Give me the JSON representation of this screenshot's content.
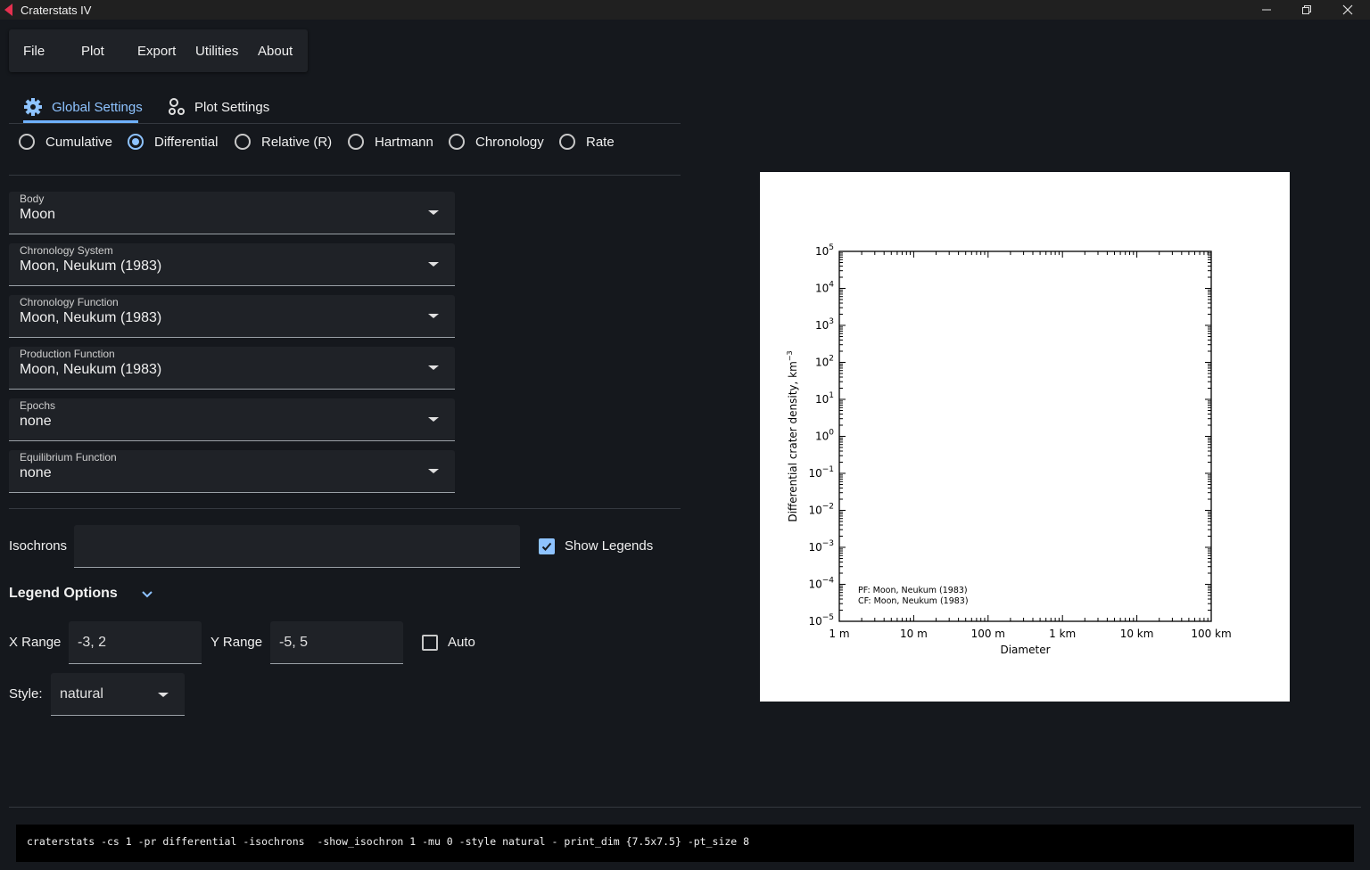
{
  "window": {
    "title": "Craterstats IV"
  },
  "menu": {
    "file": "File",
    "plot": "Plot",
    "export": "Export",
    "utilities": "Utilities",
    "about": "About"
  },
  "tabs": {
    "global": "Global Settings",
    "plot": "Plot Settings"
  },
  "presentation": {
    "options": [
      "Cumulative",
      "Differential",
      "Relative (R)",
      "Hartmann",
      "Chronology",
      "Rate"
    ],
    "selected": "Differential"
  },
  "fields": {
    "body": {
      "label": "Body",
      "value": "Moon"
    },
    "chronology_system": {
      "label": "Chronology System",
      "value": "Moon, Neukum (1983)"
    },
    "chronology_function": {
      "label": "Chronology Function",
      "value": "Moon, Neukum (1983)"
    },
    "production_function": {
      "label": "Production Function",
      "value": "Moon, Neukum (1983)"
    },
    "epochs": {
      "label": "Epochs",
      "value": "none"
    },
    "equilibrium_function": {
      "label": "Equilibrium Function",
      "value": "none"
    }
  },
  "isochrons": {
    "label": "Isochrons",
    "value": ""
  },
  "show_legends": {
    "label": "Show Legends",
    "checked": true
  },
  "legend_options": {
    "label": "Legend Options"
  },
  "x_range": {
    "label": "X Range",
    "value": "-3, 2"
  },
  "y_range": {
    "label": "Y Range",
    "value": "-5, 5"
  },
  "auto": {
    "label": "Auto",
    "checked": false
  },
  "style": {
    "label": "Style:",
    "value": "natural"
  },
  "command": "craterstats -cs 1 -pr differential -isochrons  -show_isochron 1 -mu 0 -style natural - print_dim {7.5x7.5} -pt_size 8",
  "chart_data": {
    "type": "scatter",
    "xlabel": "Diameter",
    "ylabel": "Differential crater density, km",
    "ylabel_sup": "−3",
    "x_scale": "log",
    "y_scale": "log",
    "x_ticks": [
      "1 m",
      "10 m",
      "100 m",
      "1 km",
      "10 km",
      "100 km"
    ],
    "x_range_log10_km": [
      -3,
      2
    ],
    "y_range_log10": [
      -5,
      5
    ],
    "y_ticks": [
      {
        "base": "10",
        "exp": "5"
      },
      {
        "base": "10",
        "exp": "4"
      },
      {
        "base": "10",
        "exp": "3"
      },
      {
        "base": "10",
        "exp": "2"
      },
      {
        "base": "10",
        "exp": "1"
      },
      {
        "base": "10",
        "exp": "0"
      },
      {
        "base": "10",
        "exp": "−1"
      },
      {
        "base": "10",
        "exp": "−2"
      },
      {
        "base": "10",
        "exp": "−3"
      },
      {
        "base": "10",
        "exp": "−4"
      },
      {
        "base": "10",
        "exp": "−5"
      }
    ],
    "legend": [
      "PF: Moon, Neukum (1983)",
      "CF: Moon, Neukum (1983)"
    ],
    "legend_position": "bottom-left",
    "series": []
  }
}
